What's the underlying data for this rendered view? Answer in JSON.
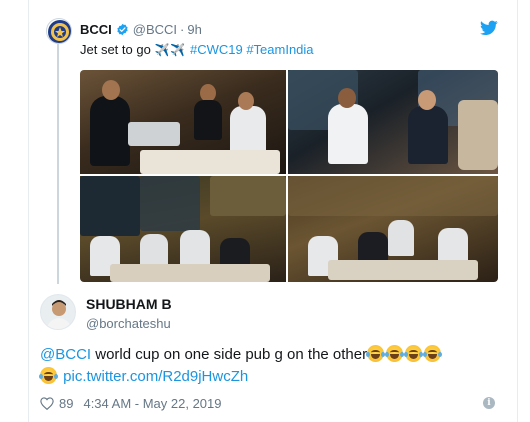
{
  "quoted_tweet": {
    "name": "BCCI",
    "handle": "@BCCI",
    "separator": "·",
    "time": "9h",
    "text_prefix": "Jet set to go",
    "text_emoji": "✈️✈️",
    "hashtags": "#CWC19 #TeamIndia",
    "photos": [
      "photo-1",
      "photo-2",
      "photo-3",
      "photo-4"
    ],
    "avatar_icon": "bcci-logo-icon",
    "verified_icon": "verified-badge-icon",
    "source_icon": "twitter-bird-icon"
  },
  "reply_tweet": {
    "name": "SHUBHAM B",
    "handle": "@borchateshu",
    "mention": "@BCCI",
    "text": " world cup on one side pub g on the other",
    "link": "pic.twitter.com/R2d9jHwcZh",
    "emoji_icon": "face-with-tears-of-joy-icon",
    "likes": "89",
    "timestamp": "4:34 AM - May 22, 2019",
    "like_icon": "heart-icon",
    "info_icon": "info-icon"
  },
  "colors": {
    "link": "#1b95e0",
    "muted": "#657786",
    "text": "#14171a",
    "border": "#e6ecf0"
  }
}
